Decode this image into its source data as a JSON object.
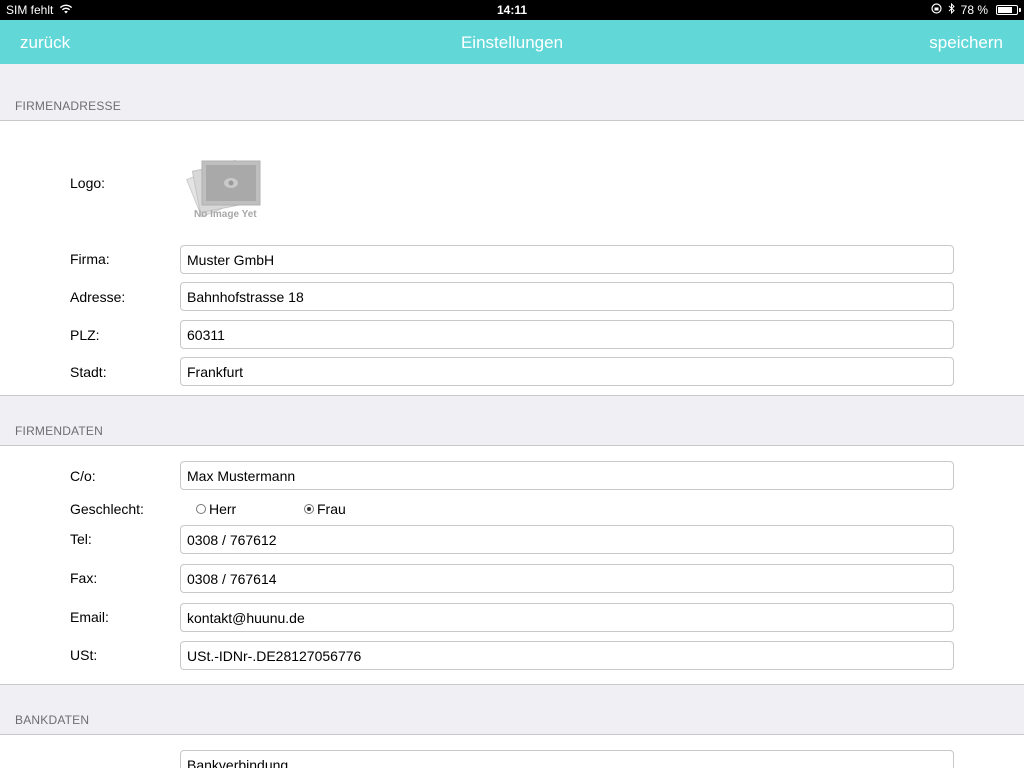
{
  "status_bar": {
    "carrier": "SIM fehlt",
    "time": "14:11",
    "battery_percent": "78 %",
    "battery_level": 0.78,
    "icons": [
      "wifi-icon",
      "orientation-lock-icon",
      "bluetooth-icon",
      "battery-icon"
    ]
  },
  "nav": {
    "back_label": "zurück",
    "title": "Einstellungen",
    "save_label": "speichern"
  },
  "colors": {
    "nav_background": "#62d7d8",
    "page_background": "#efeff4"
  },
  "firmenadresse": {
    "header": "FIRMENADRESSE",
    "logo_label": "Logo:",
    "logo_placeholder_text": "No Image Yet",
    "firma_label": "Firma:",
    "firma_value": "Muster GmbH",
    "adresse_label": "Adresse:",
    "adresse_value": "Bahnhofstrasse 18",
    "plz_label": "PLZ:",
    "plz_value": "60311",
    "stadt_label": "Stadt:",
    "stadt_value": "Frankfurt"
  },
  "firmendaten": {
    "header": "FIRMENDATEN",
    "co_label": "C/o:",
    "co_value": "Max Mustermann",
    "geschlecht_label": "Geschlecht:",
    "geschlecht_options": [
      "Herr",
      "Frau"
    ],
    "geschlecht_selected": "Frau",
    "tel_label": "Tel:",
    "tel_value": "0308 / 767612",
    "fax_label": "Fax:",
    "fax_value": "0308 / 767614",
    "email_label": "Email:",
    "email_value": "kontakt@huunu.de",
    "ust_label": "USt:",
    "ust_value": "USt.-IDNr-.DE28127056776"
  },
  "bankdaten": {
    "header": "BANKDATEN",
    "bankverbindung_placeholder": "Bankverbindung"
  }
}
